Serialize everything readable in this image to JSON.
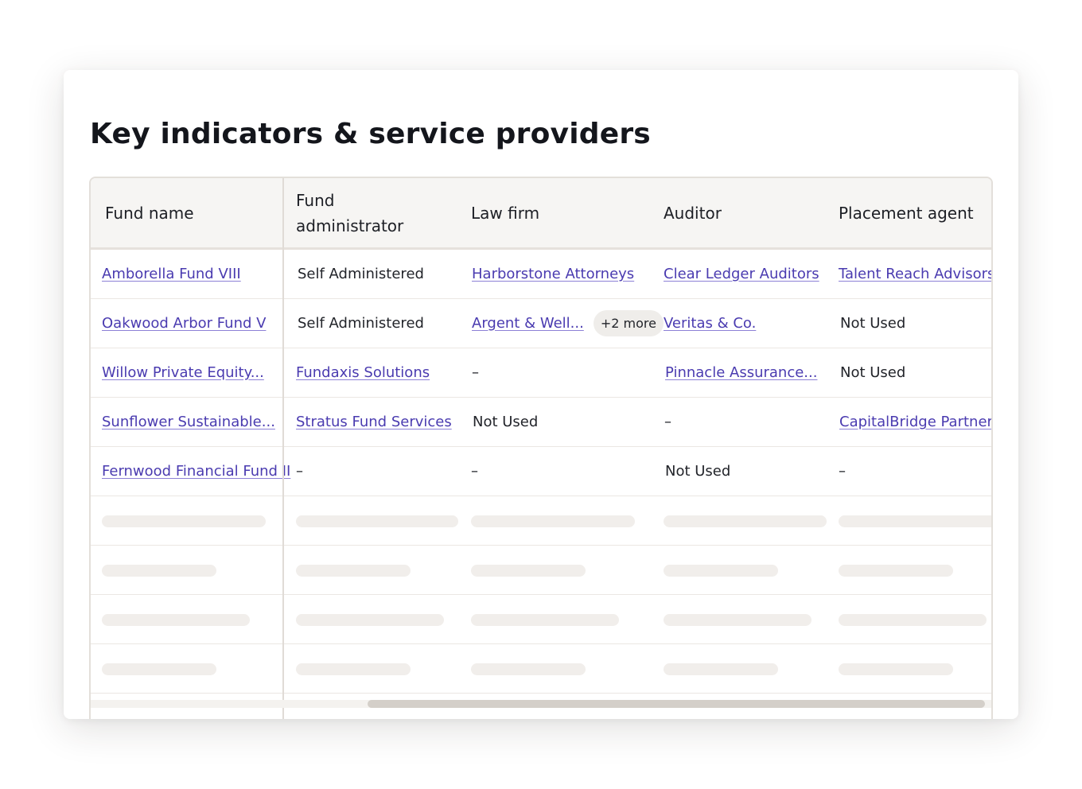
{
  "section": {
    "title": "Key indicators & service providers"
  },
  "table": {
    "headers": {
      "fund_name": "Fund name",
      "fund_administrator": "Fund administrator",
      "law_firm": "Law firm",
      "auditor": "Auditor",
      "placement_agent": "Placement agent"
    },
    "rows": [
      {
        "fund_name": "Amborella Fund VIII",
        "fund_administrator": "Self Administered",
        "law_firm": "Harborstone Attorneys",
        "law_firm_more": "",
        "auditor": "Clear Ledger Auditors",
        "placement_agent": "Talent Reach Advisors"
      },
      {
        "fund_name": "Oakwood Arbor Fund V",
        "fund_administrator": "Self Administered",
        "law_firm": "Argent & Well...",
        "law_firm_more": "+2 more",
        "auditor": "Veritas & Co.",
        "placement_agent": "Not Used"
      },
      {
        "fund_name": "Willow Private Equity...",
        "fund_administrator": "Fundaxis Solutions",
        "law_firm": "–",
        "law_firm_more": "",
        "auditor": "Pinnacle Assurance...",
        "placement_agent": "Not Used"
      },
      {
        "fund_name": "Sunflower Sustainable...",
        "fund_administrator": "Stratus Fund Services",
        "law_firm": "Not Used",
        "law_firm_more": "",
        "auditor": "–",
        "placement_agent": "CapitalBridge Partners"
      },
      {
        "fund_name": "Fernwood Financial Fund II",
        "fund_administrator": "–",
        "law_firm": "–",
        "law_firm_more": "",
        "auditor": "Not Used",
        "placement_agent": "–"
      }
    ],
    "loading_rows": 4
  }
}
